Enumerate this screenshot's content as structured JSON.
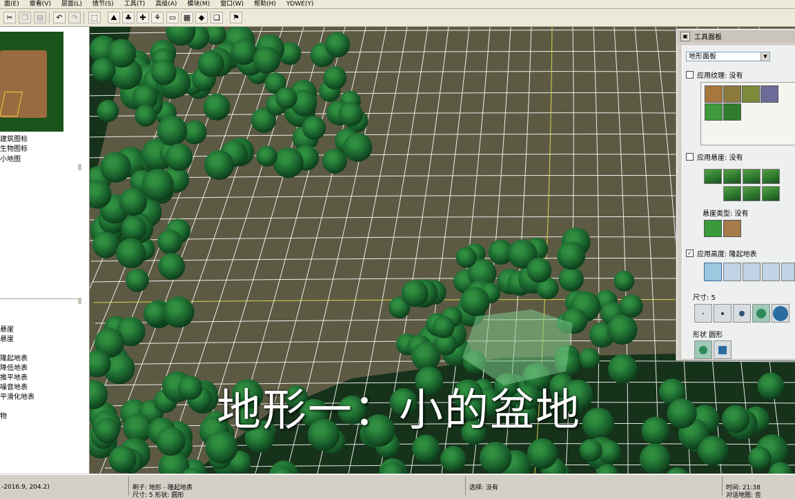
{
  "menu": [
    "面(E)",
    "察看(V)",
    "层面(L)",
    "情节(S)",
    "工具(T)",
    "高级(A)",
    "模块(M)",
    "窗口(W)",
    "帮助(H)",
    "YDWE(Y)"
  ],
  "left_panel": {
    "checks": [
      "建筑图标",
      "生物图标",
      "小地图"
    ],
    "brush_items": [
      "悬崖",
      "悬崖",
      "隆起地表",
      "降低地表",
      "推平地表",
      "噪音地表",
      "平滑化地表",
      "物"
    ]
  },
  "tool_panel": {
    "title": "工具面板",
    "palette_select": "地形面板",
    "apply_texture": "应用纹理: 没有",
    "apply_cliff": "应用悬崖: 没有",
    "cliff_type": "悬崖类型: 没有",
    "apply_height": "应用高度: 隆起地表",
    "apply_height_checked": true,
    "size_label": "尺寸: 5",
    "shape_label": "形状  圆形",
    "selected_size": 5
  },
  "caption": "地形一：小的盆地",
  "status": {
    "coords": "-2016.9, 204.2)",
    "brush": "刷子: 地形 - 隆起地表",
    "brush_shape": "尺寸: 5  形状: 圆形",
    "selection": "选择: 没有",
    "time": "时间: 21:38",
    "misc": "对话地图: 否"
  },
  "colors": {
    "grid_white": "#ffffff",
    "grid_yellow": "#e8e24a",
    "terrain": "#5d5a44",
    "tree_dark": "#0f4a22",
    "tree_light": "#2f8a3d"
  }
}
